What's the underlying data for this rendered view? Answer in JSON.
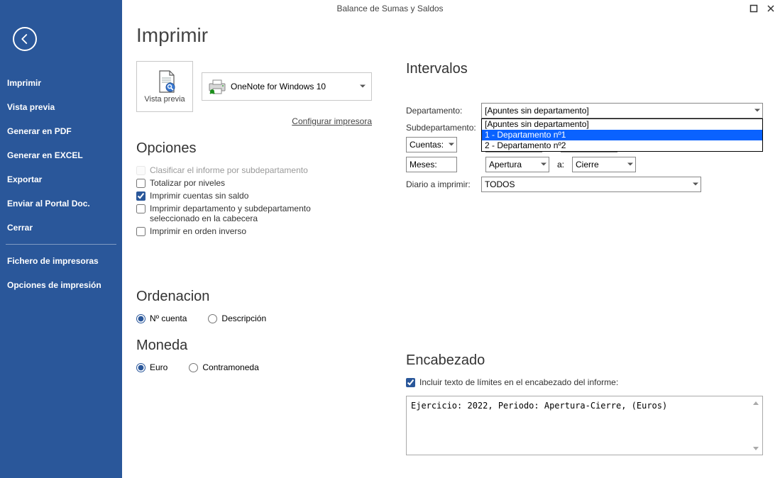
{
  "window": {
    "title": "Balance de Sumas y Saldos"
  },
  "sidebar": {
    "items": [
      {
        "label": "Imprimir"
      },
      {
        "label": "Vista previa"
      },
      {
        "label": "Generar en PDF"
      },
      {
        "label": "Generar en EXCEL"
      },
      {
        "label": "Exportar"
      },
      {
        "label": "Enviar al Portal Doc."
      },
      {
        "label": "Cerrar"
      }
    ],
    "secondary": [
      {
        "label": "Fichero de impresoras"
      },
      {
        "label": "Opciones de impresión"
      }
    ]
  },
  "headings": {
    "main": "Imprimir",
    "opciones": "Opciones",
    "ordenacion": "Ordenacion",
    "moneda": "Moneda",
    "intervalos": "Intervalos",
    "encabezado": "Encabezado"
  },
  "preview": {
    "button_label": "Vista previa",
    "printer_name": "OneNote for Windows 10",
    "config_link": "Configurar impresora"
  },
  "opciones": {
    "clasificar": "Clasificar el informe por subdepartamento",
    "totalizar": "Totalizar por niveles",
    "imprimir_sin_saldo": "Imprimir cuentas sin saldo",
    "imprimir_dept": "Imprimir departamento y subdepartamento seleccionado en la cabecera",
    "orden_inverso": "Imprimir en orden inverso"
  },
  "ordenacion": {
    "cuenta": "Nº cuenta",
    "descripcion": "Descripción"
  },
  "moneda": {
    "euro": "Euro",
    "contramoneda": "Contramoneda"
  },
  "intervalos": {
    "departamento_label": "Departamento:",
    "departamento_value": "[Apuntes sin departamento]",
    "departamento_options": [
      "[Apuntes sin departamento]",
      "1 - Departamento nº1",
      "2 - Departamento nº2"
    ],
    "subdepartamento_label": "Subdepartamento:",
    "cuentas_label": "Cuentas:",
    "meses_label": "Meses:",
    "mes_desde": "Apertura",
    "a_label": "a:",
    "mes_hasta": "Cierre",
    "diario_label": "Diario a imprimir:",
    "diario_value": "TODOS"
  },
  "encabezado": {
    "check_label": "Incluir texto de límites en el encabezado del informe:",
    "text": "Ejercicio: 2022, Periodo: Apertura-Cierre, (Euros)"
  }
}
